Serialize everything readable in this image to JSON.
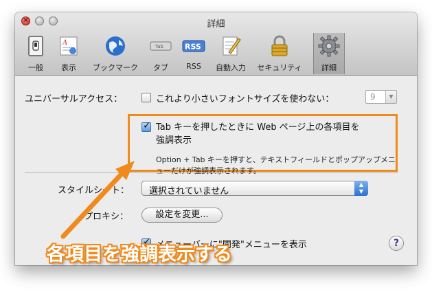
{
  "window": {
    "title": "詳細"
  },
  "toolbar": {
    "items": [
      {
        "label": "一般",
        "icon": "general-switch-icon"
      },
      {
        "label": "表示",
        "icon": "appearance-icon"
      },
      {
        "label": "ブックマーク",
        "icon": "globe-icon"
      },
      {
        "label": "タブ",
        "icon": "tab-icon"
      },
      {
        "label": "RSS",
        "icon": "rss-icon"
      },
      {
        "label": "自動入力",
        "icon": "autofill-icon"
      },
      {
        "label": "セキュリティ",
        "icon": "lock-icon"
      },
      {
        "label": "詳細",
        "icon": "gear-icon",
        "selected": true
      }
    ],
    "tab_icon_text": "Tab",
    "rss_icon_text": "RSS"
  },
  "accessibility": {
    "label": "ユニバーサルアクセス：",
    "min_font_label": "これより小さいフォントサイズを使わない：",
    "min_font_checked": false,
    "min_font_value": "9",
    "tab_highlight_label_line1": "Tab キーを押したときに Web ページ上の各項目を",
    "tab_highlight_label_line2": "強調表示",
    "tab_highlight_checked": true,
    "tab_highlight_desc": "Option + Tab キーを押すと、テキストフィールドとポップアップメニューだけが強調表示されます。"
  },
  "stylesheet": {
    "label": "スタイルシート：",
    "value": "選択されていません"
  },
  "proxy": {
    "label": "プロキシ：",
    "button": "設定を変更..."
  },
  "develop_menu": {
    "label": "メニューバーに\"開発\"メニューを表示",
    "checked": true
  },
  "help": {
    "label": "?"
  },
  "annotation": {
    "text": "各項目を強調表示する"
  },
  "colors": {
    "accent": "#f08a1c"
  }
}
